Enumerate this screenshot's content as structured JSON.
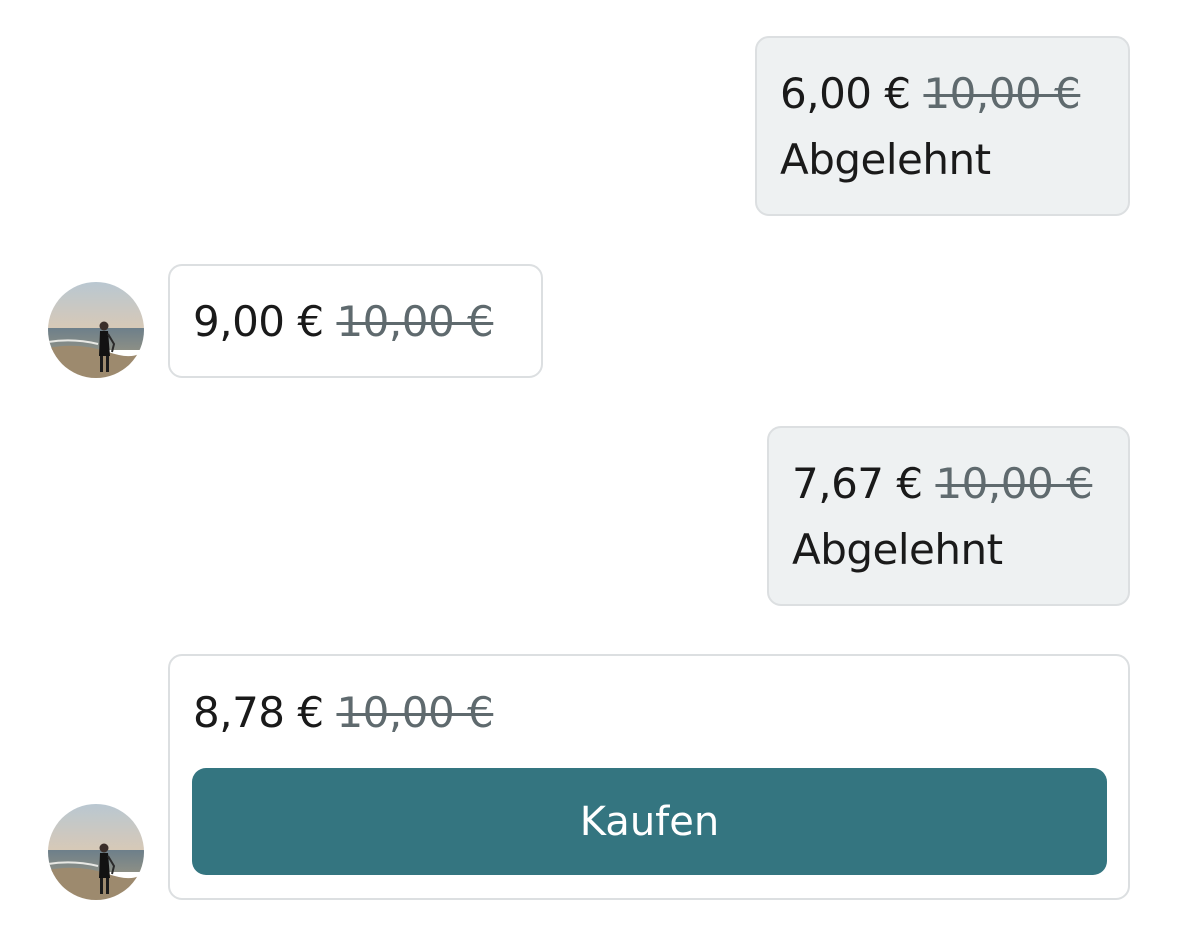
{
  "messages": [
    {
      "price": "6,00 €",
      "original_price": "10,00 €",
      "status": "Abgelehnt"
    },
    {
      "price": "9,00 €",
      "original_price": "10,00 €"
    },
    {
      "price": "7,67 €",
      "original_price": "10,00 €",
      "status": "Abgelehnt"
    },
    {
      "price": "8,78 €",
      "original_price": "10,00 €",
      "button_label": "Kaufen"
    }
  ],
  "colors": {
    "button": "#347580",
    "outgoing_bubble": "#eef1f2",
    "border": "#dcdfe1",
    "strike_text": "#5f6a6e"
  }
}
